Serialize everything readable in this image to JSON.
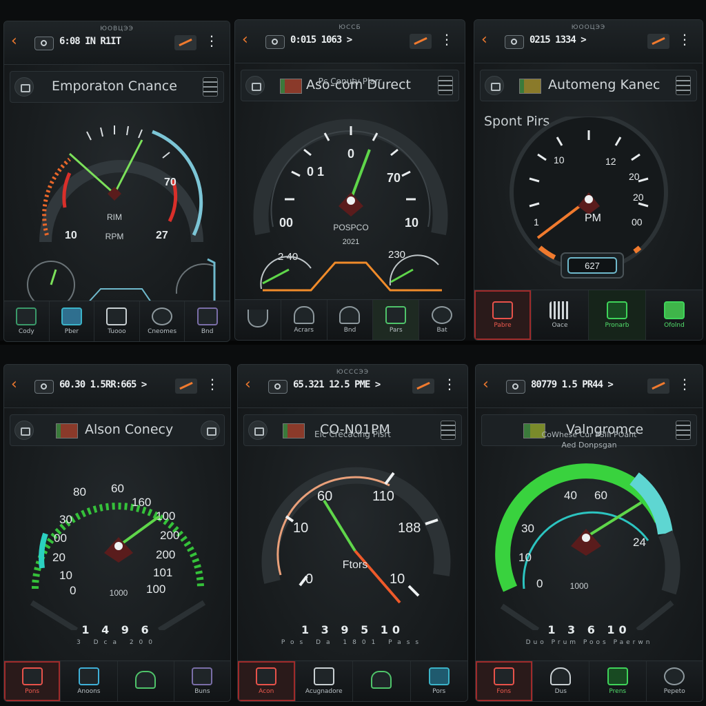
{
  "panels": [
    {
      "header_sub": "ЮОВЦЭЭ",
      "time": "6:08 IN R1IT",
      "title": "Emporaton Cnance",
      "caption": "",
      "heading": "",
      "gauge": {
        "style": "multi",
        "labels": [
          "10",
          "70",
          "27"
        ],
        "center_top": "RIM",
        "center_bottom": "RPM",
        "needle_value": 0.62
      },
      "bottom_values": "",
      "bottom_units": "",
      "buttons": [
        {
          "label": "Cody",
          "icon": "chart-icon"
        },
        {
          "label": "Pber",
          "icon": "wrench-icon"
        },
        {
          "label": "Tuooo",
          "icon": "monitor-icon"
        },
        {
          "label": "Cneomes",
          "icon": "gauge-icon"
        },
        {
          "label": "Bnd",
          "icon": "display-icon"
        }
      ]
    },
    {
      "header_sub": "ЮССБ",
      "time": "0:015 1063 >",
      "title": "Aso-com Durect",
      "caption": "Pc Conuty Plarr",
      "heading": "",
      "gauge": {
        "style": "needle",
        "labels": [
          "0",
          "0 1",
          "70",
          "00",
          "10",
          "2 40",
          "230"
        ],
        "center_top": "POSPCO",
        "center_bottom": "2021",
        "needle_value": 0.55
      },
      "bottom_values": "",
      "bottom_units": "",
      "buttons": [
        {
          "label": "",
          "icon": "bridge-icon"
        },
        {
          "label": "Acrars",
          "icon": "car-icon"
        },
        {
          "label": "Bnd",
          "icon": "wifi-icon"
        },
        {
          "label": "Pars",
          "icon": "home-icon"
        },
        {
          "label": "Bat",
          "icon": "search-icon"
        }
      ]
    },
    {
      "header_sub": "ЮООЦЭЭ",
      "time": "0215 1334 >",
      "title": "Automeng Kanec",
      "caption": "",
      "heading": "Spont Pirs",
      "gauge": {
        "style": "speed",
        "labels": [
          "10",
          "12",
          "20",
          "20",
          "00",
          "1",
          "PM"
        ],
        "center_top": "PM",
        "center_bottom": "",
        "readout": "627",
        "needle_value": 0.28
      },
      "bottom_values": "",
      "bottom_units": "",
      "buttons": [
        {
          "label": "Pabre",
          "icon": "save-icon"
        },
        {
          "label": "Oace",
          "icon": "barcode-icon"
        },
        {
          "label": "Pronarb",
          "icon": "graph-icon"
        },
        {
          "label": "Ofolnd",
          "icon": "table-icon"
        }
      ]
    },
    {
      "header_sub": "",
      "time": "60.30 1.5RR:665 >",
      "title": "Alson Conecy",
      "caption": "",
      "heading": "",
      "gauge": {
        "style": "green",
        "labels": [
          "80",
          "60",
          "160",
          "30",
          "100",
          "00",
          "200",
          "20",
          "200",
          "10",
          "101",
          "0",
          "100"
        ],
        "center_top": "",
        "center_bottom": "1000",
        "needle_value": 0.7
      },
      "bottom_values": "1 4 9 6",
      "bottom_units": "3 Dca 200",
      "buttons": [
        {
          "label": "Pons",
          "icon": "car-icon"
        },
        {
          "label": "Anoons",
          "icon": "phone-icon"
        },
        {
          "label": "",
          "icon": "home-icon"
        },
        {
          "label": "Buns",
          "icon": "image-icon"
        }
      ]
    },
    {
      "header_sub": "ЮСССЭЭ",
      "time": "65.321 12.5 PME >",
      "title": "CO-N01PM",
      "caption": "Eic Crecacing Pisrt",
      "heading": "",
      "gauge": {
        "style": "orange",
        "labels": [
          "60",
          "110",
          "10",
          "188",
          "0",
          "10"
        ],
        "center_top": "Ftors",
        "center_bottom": "",
        "needle_value": 0.4
      },
      "bottom_values": "1 3 9 5 10",
      "bottom_units": "Pos Da 1801 Pass",
      "buttons": [
        {
          "label": "Acon",
          "icon": "alert-icon"
        },
        {
          "label": "Acugnadore",
          "icon": "monitor-icon"
        },
        {
          "label": "",
          "icon": "home-icon"
        },
        {
          "label": "Pors",
          "icon": "save-icon"
        }
      ]
    },
    {
      "header_sub": "",
      "time": "80779 1.5 PR44 >",
      "title": "Valngromce",
      "caption": "CoWhese Cur PSIII POant",
      "caption2": "Aed Donpsgan",
      "heading": "",
      "gauge": {
        "style": "cyan",
        "labels": [
          "40",
          "60",
          "30",
          "10",
          "0",
          "24"
        ],
        "center_top": "",
        "center_bottom": "1000",
        "needle_value": 0.72
      },
      "bottom_values": "1 3 6 10",
      "bottom_units": "Duo Prum Poos Paerwn",
      "buttons": [
        {
          "label": "Fons",
          "icon": "car-icon"
        },
        {
          "label": "Dus",
          "icon": "plane-icon"
        },
        {
          "label": "Prens",
          "icon": "save-icon"
        },
        {
          "label": "Pepeto",
          "icon": "gauge-icon"
        }
      ]
    }
  ]
}
